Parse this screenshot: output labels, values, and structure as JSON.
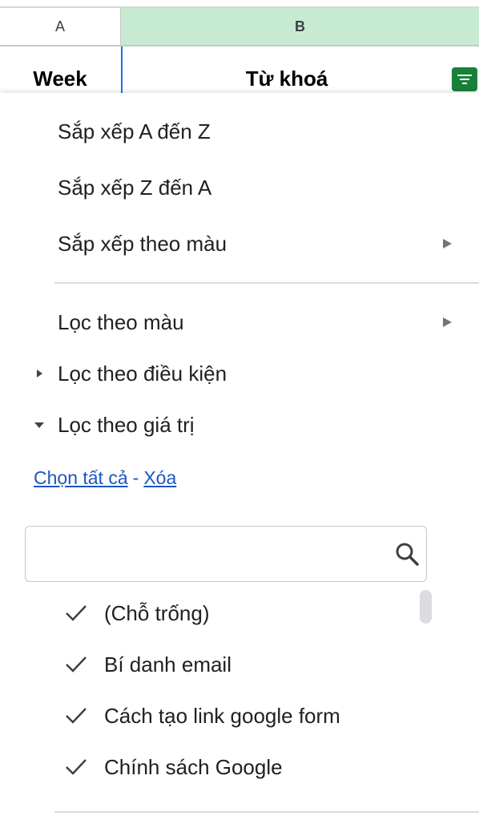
{
  "column_headers": {
    "col_a": "A",
    "col_b": "B"
  },
  "header_cells": {
    "col_a": "Week",
    "col_b": "Từ khoá"
  },
  "sort_menu": {
    "sort_az": "Sắp xếp A đến Z",
    "sort_za": "Sắp xếp Z đến A",
    "sort_by_color": "Sắp xếp theo màu"
  },
  "filter_menu": {
    "filter_by_color": "Lọc theo màu",
    "filter_by_condition": "Lọc theo điều kiện",
    "filter_by_values": "Lọc theo giá trị"
  },
  "value_actions": {
    "select_all": "Chọn tất cả",
    "separator": "-",
    "clear": "Xóa"
  },
  "search": {
    "value": "",
    "placeholder": ""
  },
  "values": [
    {
      "label": "(Chỗ trống)",
      "checked": true
    },
    {
      "label": "Bí danh email",
      "checked": true
    },
    {
      "label": "Cách tạo link google form",
      "checked": true
    },
    {
      "label": "Chính sách Google",
      "checked": true
    }
  ],
  "colors": {
    "selected_column": "#c6ebd2",
    "filter_button": "#188038",
    "link": "#1a56c2",
    "selection_border": "#1a73e8"
  },
  "icons": {
    "filter": "filter-icon",
    "search": "search-icon",
    "check": "check-icon",
    "submenu": "triangle-right-icon",
    "expand": "caret-right-icon",
    "collapse": "caret-down-icon"
  }
}
